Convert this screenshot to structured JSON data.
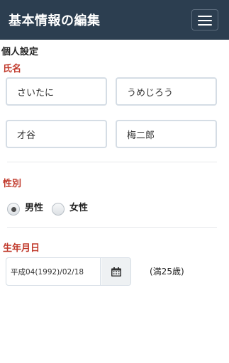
{
  "header": {
    "title": "基本情報の編集",
    "menu_icon": "hamburger-menu-icon"
  },
  "section_title": "個人設定",
  "name": {
    "label": "氏名",
    "kana_last": "さいたに",
    "kana_first": "うめじろう",
    "kanji_last": "才谷",
    "kanji_first": "梅二郎"
  },
  "gender": {
    "label": "性別",
    "options": [
      {
        "label": "男性",
        "selected": true
      },
      {
        "label": "女性",
        "selected": false
      }
    ]
  },
  "birthday": {
    "label": "生年月日",
    "value": "平成04(1992)/02/18",
    "calendar_icon": "calendar-icon",
    "age": "(満25歳)"
  },
  "colors": {
    "navbar": "#2c3e50",
    "label_red": "#c0392b"
  }
}
